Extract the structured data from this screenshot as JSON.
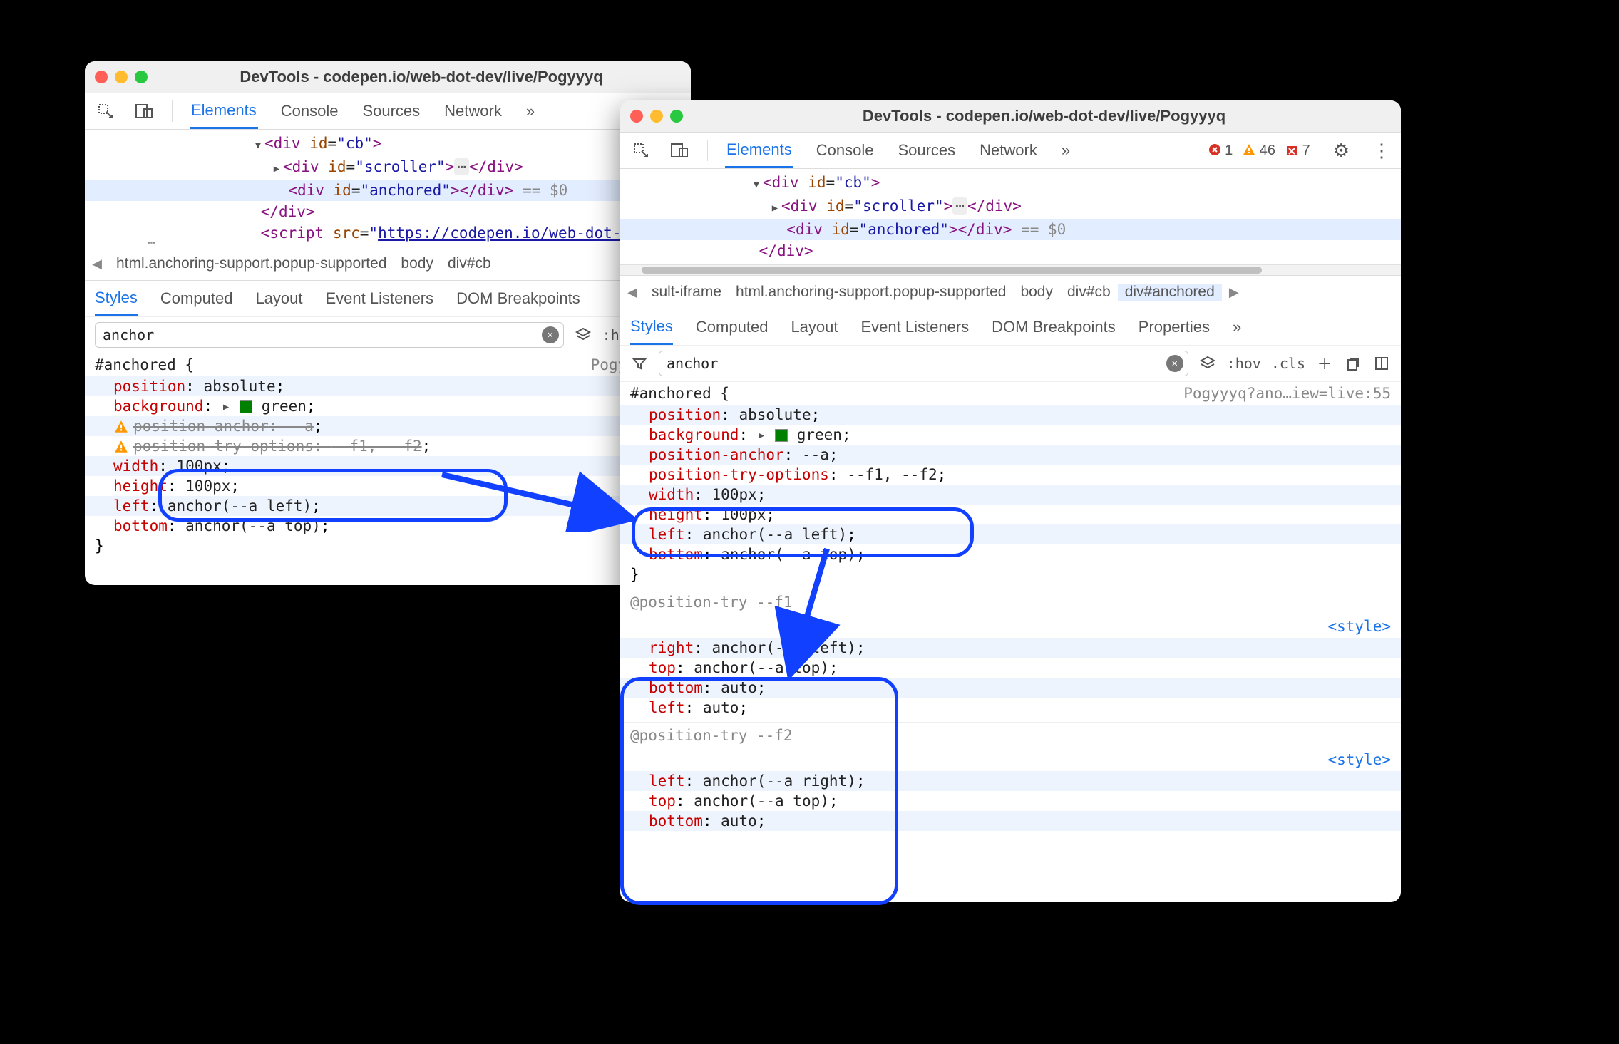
{
  "windowTitle": "DevTools - codepen.io/web-dot-dev/live/Pogyyyq",
  "mainTabs": [
    "Elements",
    "Console",
    "Sources",
    "Network"
  ],
  "subTabs": [
    "Styles",
    "Computed",
    "Layout",
    "Event Listeners",
    "DOM Breakpoints",
    "Properties"
  ],
  "filterValue": "anchor",
  "hov": ":hov",
  "cls": ".cls",
  "issues": {
    "errors": "1",
    "warnings": "46",
    "hidden": "7"
  },
  "elements": {
    "cbOpen": "<div id=\"cb\">",
    "scrollerOpen": "<div id=\"scroller\">",
    "scrollerCloseMid": "</div>",
    "anchoredOpen": "<div id=\"anchored\">",
    "anchoredClose": "</div>",
    "eq0": "== $0",
    "divClose": "</div>",
    "scriptSrc": "https://codepen.io/web-dot-d"
  },
  "breadcrumb1": [
    "html.anchoring-support.popup-supported",
    "body",
    "div#cb"
  ],
  "breadcrumb2": [
    "sult-iframe",
    "html.anchoring-support.popup-supported",
    "body",
    "div#cb",
    "div#anchored"
  ],
  "srcLabel1": "Pogyyyq?an",
  "srcLabel2": "Pogyyyq?ano…iew=live:55",
  "styleLink": "<style>",
  "rule": {
    "selector": "#anchored {",
    "close": "}",
    "decls": [
      {
        "p": "position",
        "v": "absolute"
      },
      {
        "p": "background",
        "v": "green",
        "swatch": true,
        "expand": true
      },
      {
        "p": "position-anchor",
        "v": "--a"
      },
      {
        "p": "position-try-options",
        "v": "--f1, --f2"
      },
      {
        "p": "width",
        "v": "100px"
      },
      {
        "p": "height",
        "v": "100px"
      },
      {
        "p": "left",
        "v": "anchor(--a left)"
      },
      {
        "p": "bottom",
        "v": "anchor(--a top)"
      }
    ]
  },
  "posTry": [
    {
      "name": "@position-try --f1",
      "decls": [
        {
          "p": "right",
          "v": "anchor(--a left)"
        },
        {
          "p": "top",
          "v": "anchor(--a top)"
        },
        {
          "p": "bottom",
          "v": "auto"
        },
        {
          "p": "left",
          "v": "auto"
        }
      ]
    },
    {
      "name": "@position-try --f2",
      "decls": [
        {
          "p": "left",
          "v": "anchor(--a right)"
        },
        {
          "p": "top",
          "v": "anchor(--a top)"
        },
        {
          "p": "bottom",
          "v": "auto"
        }
      ]
    }
  ]
}
